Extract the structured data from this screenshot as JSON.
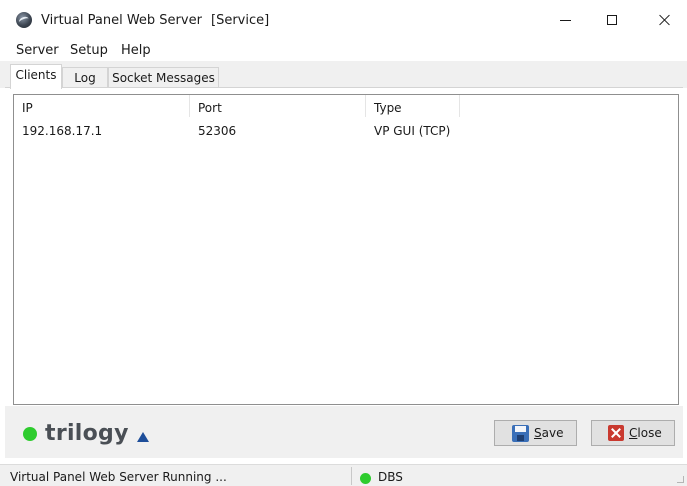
{
  "window": {
    "title": "Virtual Panel Web Server",
    "title_suffix": "[Service]"
  },
  "menu": [
    "Server",
    "Setup",
    "Help"
  ],
  "tabs": [
    "Clients",
    "Log",
    "Socket Messages"
  ],
  "active_tab": "Clients",
  "clients_table": {
    "columns": [
      "IP",
      "Port",
      "Type"
    ],
    "rows": [
      {
        "ip": "192.168.17.1",
        "port": "52306",
        "type": "VP GUI (TCP)"
      }
    ]
  },
  "footer": {
    "logo_text": "trilogy",
    "save_button": {
      "accel": "S",
      "rest": "ave"
    },
    "close_button": {
      "accel": "C",
      "rest": "lose"
    }
  },
  "status": {
    "message": "Virtual Panel Web Server Running ...",
    "db_label": "DBS",
    "db_indicator_color": "#2ecc2e"
  },
  "icons": {
    "app": "globe-app-icon",
    "save": "floppy-disk-icon",
    "close": "red-x-icon"
  }
}
